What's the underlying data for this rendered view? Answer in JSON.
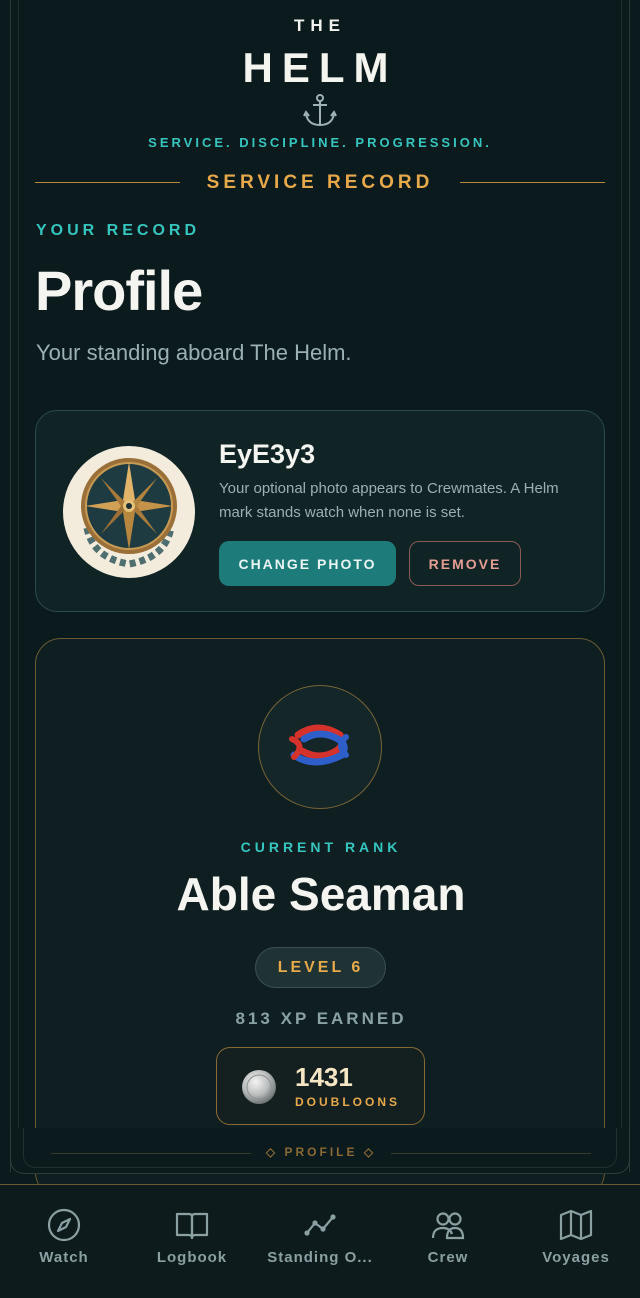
{
  "brand": {
    "the": "THE",
    "name": "HELM",
    "tagline": "SERVICE. DISCIPLINE. PROGRESSION."
  },
  "section": {
    "title": "SERVICE RECORD"
  },
  "header": {
    "eyebrow": "YOUR RECORD",
    "title": "Profile",
    "subtitle": "Your standing aboard The Helm."
  },
  "profile": {
    "username": "EyE3y3",
    "description": "Your optional photo appears to Crewmates. A Helm mark stands watch when none is set.",
    "change_label": "CHANGE PHOTO",
    "remove_label": "REMOVE",
    "avatar_icon": "compass-rose-icon"
  },
  "rank": {
    "label": "CURRENT RANK",
    "name": "Able Seaman",
    "level": "LEVEL 6",
    "xp": "813 XP EARNED",
    "emblem_icon": "knot-icon"
  },
  "wallet": {
    "amount": "1431",
    "label": "DOUBLOONS",
    "icon": "coin-icon"
  },
  "footer_strip": {
    "label": "◇ PROFILE ◇"
  },
  "nav": [
    {
      "label": "Watch",
      "icon": "compass-icon"
    },
    {
      "label": "Logbook",
      "icon": "book-icon"
    },
    {
      "label": "Standing O...",
      "icon": "chart-icon"
    },
    {
      "label": "Crew",
      "icon": "crew-icon"
    },
    {
      "label": "Voyages",
      "icon": "map-icon"
    }
  ],
  "colors": {
    "teal": "#35c6bf",
    "gold": "#e7a94a",
    "bg": "#0b1a1c",
    "button": "#1d7c7a",
    "remove": "#e59e93"
  }
}
